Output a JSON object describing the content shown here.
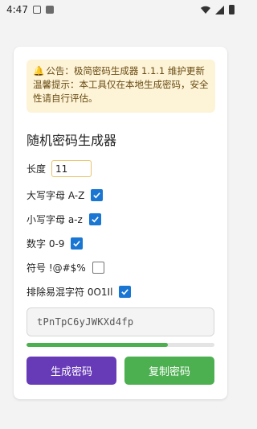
{
  "statusbar": {
    "time": "4:47"
  },
  "notice": {
    "icon": "bell-icon",
    "text": "公告：极简密码生成器 1.1.1 维护更新温馨提示：本工具仅在本地生成密码，安全性请自行评估。"
  },
  "title": "随机密码生成器",
  "length": {
    "label": "长度",
    "value": "11"
  },
  "options": [
    {
      "label": "大写字母 A-Z",
      "checked": true
    },
    {
      "label": "小写字母 a-z",
      "checked": true
    },
    {
      "label": "数字 0-9",
      "checked": true
    },
    {
      "label": "符号 !@#$%",
      "checked": false
    },
    {
      "label": "排除易混字符 0O1Il",
      "checked": true
    }
  ],
  "password": "tPnTpC6yJWKXd4fp",
  "strength": 0.75,
  "buttons": {
    "generate": "生成密码",
    "copy": "复制密码"
  },
  "colors": {
    "primary": "#673ab7",
    "success": "#4caf50",
    "checkbox": "#1976d2",
    "notice_bg": "#fdf3d7"
  }
}
